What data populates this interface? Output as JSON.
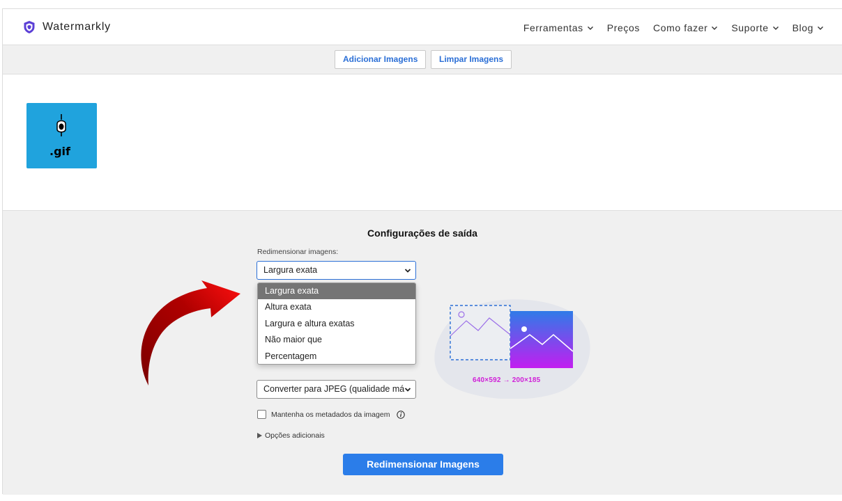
{
  "header": {
    "logo_text": "Watermarkly",
    "nav": [
      {
        "label": "Ferramentas",
        "has_chevron": true
      },
      {
        "label": "Preços",
        "has_chevron": false
      },
      {
        "label": "Como fazer",
        "has_chevron": true
      },
      {
        "label": "Suporte",
        "has_chevron": true
      },
      {
        "label": "Blog",
        "has_chevron": true
      }
    ]
  },
  "toolbar": {
    "add_label": "Adicionar Imagens",
    "clear_label": "Limpar Imagens"
  },
  "images": [
    {
      "extension_label": ".gif"
    }
  ],
  "settings": {
    "title": "Configurações de saída",
    "resize_label": "Redimensionar imagens:",
    "resize_selected": "Largura exata",
    "resize_options": [
      "Largura exata",
      "Altura exata",
      "Largura e altura exatas",
      "Não maior que",
      "Percentagem"
    ],
    "format_selected": "Converter para JPEG (qualidade má",
    "keep_metadata_label": "Mantenha os metadados da imagem",
    "keep_metadata_checked": false,
    "additional_options_label": "Opções adicionais",
    "submit_label": "Redimensionar Imagens",
    "illustration_caption": "640×592 → 200×185"
  },
  "colors": {
    "accent": "#2b7de9",
    "thumb_bg": "#20a3dd",
    "annotation_arrow": "#c00000",
    "caption": "#d020d8"
  }
}
